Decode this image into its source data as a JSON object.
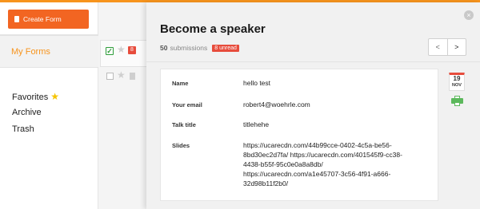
{
  "sidebar": {
    "create_button_label": "Create Form",
    "my_forms_label": "My Forms",
    "favorites_label": "Favorites",
    "archive_label": "Archive",
    "trash_label": "Trash"
  },
  "list": {
    "selected_badge": "8"
  },
  "panel": {
    "title": "Become a speaker",
    "submissions_count": "50",
    "submissions_label": "submissions",
    "unread_label": "8 unread",
    "prev_label": "<",
    "next_label": ">",
    "close_label": "×"
  },
  "submission": {
    "fields": [
      {
        "label": "Name",
        "value_lines": [
          "hello test"
        ]
      },
      {
        "label": "Your email",
        "value_lines": [
          "robert4@woehrle.com"
        ]
      },
      {
        "label": "Talk title",
        "value_lines": [
          "titlehehe"
        ]
      },
      {
        "label": "Slides",
        "value_lines": [
          "https://ucarecdn.com/44b99cce-0402-4c5a-be56-",
          "8bd30ec2d7fa/ https://ucarecdn.com/401545f9-cc38-",
          "4438-b55f-95c0e0a8a8db/",
          "https://ucarecdn.com/a1e45707-3c56-4f91-a666-",
          "32d98b11f2b0/"
        ]
      }
    ]
  },
  "date_badge": {
    "day": "19",
    "month": "NOV"
  },
  "colors": {
    "accent": "#f7941d",
    "create_button": "#f26522",
    "badge": "#e74c3c",
    "print_icon": "#5cb85c"
  }
}
